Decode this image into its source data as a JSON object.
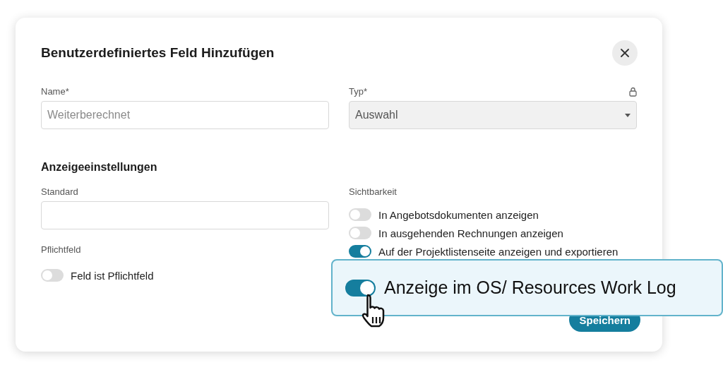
{
  "dialog": {
    "title": "Benutzerdefiniertes Feld Hinzufügen",
    "name_field": {
      "label": "Name*",
      "placeholder": "Weiterberechnet"
    },
    "type_field": {
      "label": "Typ*",
      "value": "Auswahl",
      "locked": true
    },
    "section_title": "Anzeigeeinstellungen",
    "default_field": {
      "label": "Standard"
    },
    "required": {
      "label": "Pflichtfeld",
      "toggle": {
        "label": "Feld ist Pflichtfeld",
        "on": false
      }
    },
    "visibility": {
      "label": "Sichtbarkeit",
      "toggles": [
        {
          "label": "In Angebotsdokumenten anzeigen",
          "on": false
        },
        {
          "label": "In ausgehenden Rechnungen anzeigen",
          "on": false
        },
        {
          "label": "Auf der Projektlistenseite anzeigen und exportieren",
          "on": true
        }
      ]
    },
    "save_button": "Speichern"
  },
  "callout": {
    "label": "Anzeige im OS/ Resources Work Log",
    "on": true
  }
}
